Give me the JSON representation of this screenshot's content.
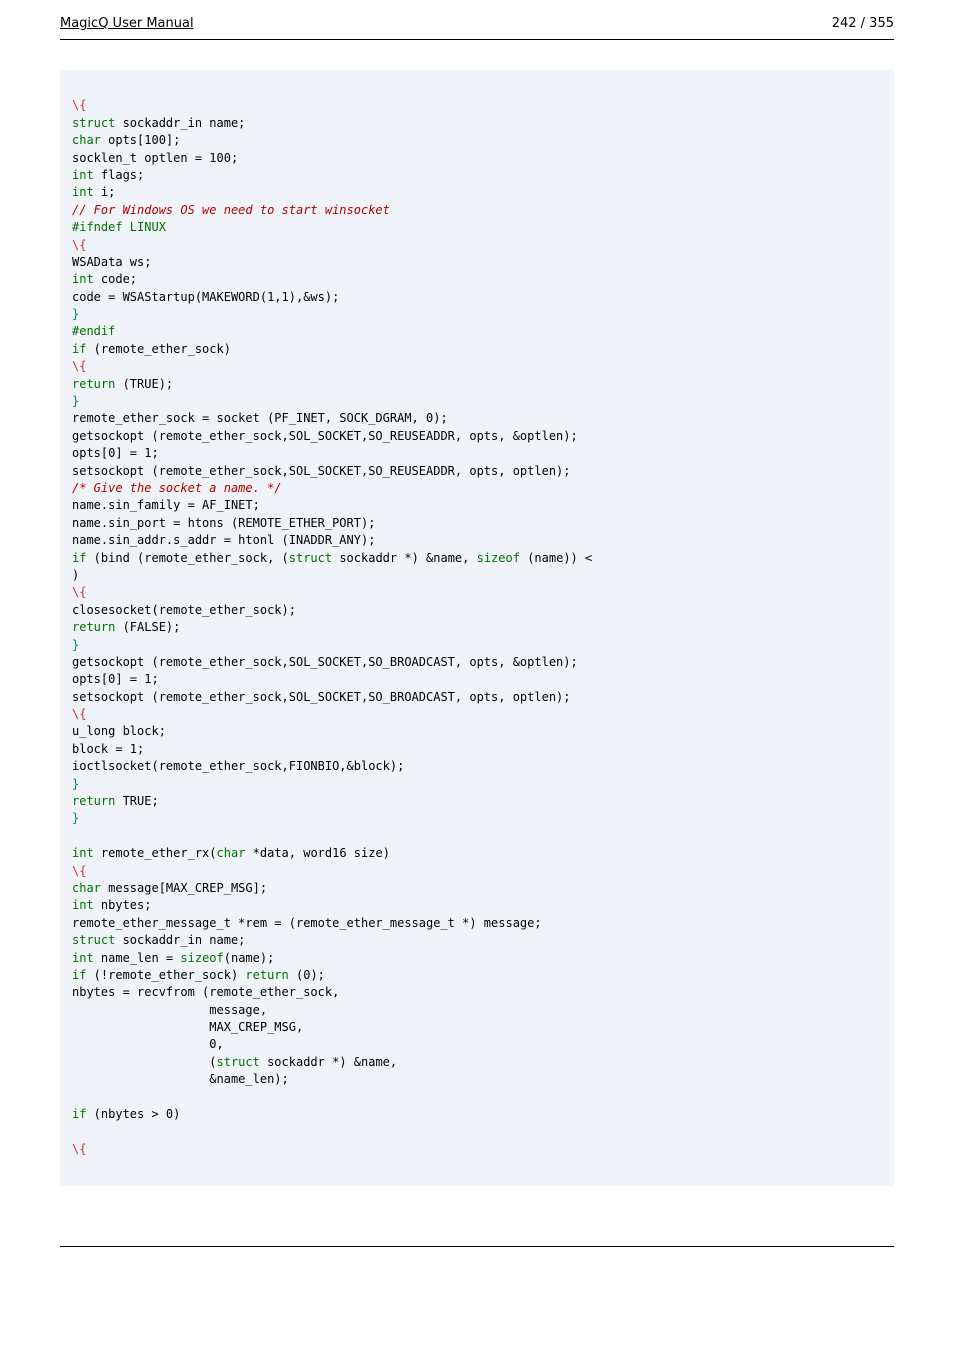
{
  "header": {
    "title_left": "MagicQ User Manual",
    "page_info": "242 / 355"
  },
  "code": {
    "lines": [
      [],
      [
        {
          "cls": "tok-bs",
          "t": "\\{"
        }
      ],
      [
        {
          "cls": "tok-kw",
          "t": "struct"
        },
        {
          "cls": "",
          "t": " sockaddr_in name;"
        }
      ],
      [
        {
          "cls": "tok-kw",
          "t": "char"
        },
        {
          "cls": "",
          "t": " opts[100];"
        }
      ],
      [
        {
          "cls": "",
          "t": "socklen_t optlen = 100;"
        }
      ],
      [
        {
          "cls": "tok-kw",
          "t": "int"
        },
        {
          "cls": "",
          "t": " flags;"
        }
      ],
      [
        {
          "cls": "tok-kw",
          "t": "int"
        },
        {
          "cls": "",
          "t": " i;"
        }
      ],
      [
        {
          "cls": "tok-comm",
          "t": "// For Windows OS we need to start winsocket"
        }
      ],
      [
        {
          "cls": "tok-pp",
          "t": "#ifndef LINUX"
        }
      ],
      [
        {
          "cls": "tok-bs",
          "t": "\\{"
        }
      ],
      [
        {
          "cls": "",
          "t": "WSAData ws;"
        }
      ],
      [
        {
          "cls": "tok-kw",
          "t": "int"
        },
        {
          "cls": "",
          "t": " code;"
        }
      ],
      [
        {
          "cls": "",
          "t": "code = WSAStartup(MAKEWORD(1,1),&ws);"
        }
      ],
      [
        {
          "cls": "tok-struct",
          "t": "}"
        }
      ],
      [
        {
          "cls": "tok-pp",
          "t": "#endif"
        }
      ],
      [
        {
          "cls": "tok-kw",
          "t": "if"
        },
        {
          "cls": "",
          "t": " (remote_ether_sock)"
        }
      ],
      [
        {
          "cls": "tok-bs",
          "t": "\\{"
        }
      ],
      [
        {
          "cls": "tok-kw",
          "t": "return"
        },
        {
          "cls": "",
          "t": " (TRUE);"
        }
      ],
      [
        {
          "cls": "tok-struct",
          "t": "}"
        }
      ],
      [
        {
          "cls": "",
          "t": "remote_ether_sock = socket (PF_INET, SOCK_DGRAM, 0);"
        }
      ],
      [
        {
          "cls": "",
          "t": "getsockopt (remote_ether_sock,SOL_SOCKET,SO_REUSEADDR, opts, &optlen);"
        }
      ],
      [
        {
          "cls": "",
          "t": "opts[0] = 1;"
        }
      ],
      [
        {
          "cls": "",
          "t": "setsockopt (remote_ether_sock,SOL_SOCKET,SO_REUSEADDR, opts, optlen);"
        }
      ],
      [
        {
          "cls": "tok-comm",
          "t": "/* Give the socket a name. */"
        }
      ],
      [
        {
          "cls": "",
          "t": "name.sin_family = AF_INET;"
        }
      ],
      [
        {
          "cls": "",
          "t": "name.sin_port = htons (REMOTE_ETHER_PORT);"
        }
      ],
      [
        {
          "cls": "",
          "t": "name.sin_addr.s_addr = htonl (INADDR_ANY);"
        }
      ],
      [
        {
          "cls": "tok-kw",
          "t": "if"
        },
        {
          "cls": "",
          "t": " (bind (remote_ether_sock, ("
        },
        {
          "cls": "tok-kw",
          "t": "struct"
        },
        {
          "cls": "",
          "t": " sockaddr *) &name, "
        },
        {
          "cls": "tok-kw",
          "t": "sizeof"
        },
        {
          "cls": "",
          "t": " (name)) <"
        }
      ],
      [
        {
          "cls": "",
          "t": ")"
        }
      ],
      [
        {
          "cls": "tok-bs",
          "t": "\\{"
        }
      ],
      [
        {
          "cls": "",
          "t": "closesocket(remote_ether_sock);"
        }
      ],
      [
        {
          "cls": "tok-kw",
          "t": "return"
        },
        {
          "cls": "",
          "t": " (FALSE);"
        }
      ],
      [
        {
          "cls": "tok-struct",
          "t": "}"
        }
      ],
      [
        {
          "cls": "",
          "t": "getsockopt (remote_ether_sock,SOL_SOCKET,SO_BROADCAST, opts, &optlen);"
        }
      ],
      [
        {
          "cls": "",
          "t": "opts[0] = 1;"
        }
      ],
      [
        {
          "cls": "",
          "t": "setsockopt (remote_ether_sock,SOL_SOCKET,SO_BROADCAST, opts, optlen);"
        }
      ],
      [
        {
          "cls": "tok-bs",
          "t": "\\{"
        }
      ],
      [
        {
          "cls": "",
          "t": "u_long block;"
        }
      ],
      [
        {
          "cls": "",
          "t": "block = 1;"
        }
      ],
      [
        {
          "cls": "",
          "t": "ioctlsocket(remote_ether_sock,FIONBIO,&block);"
        }
      ],
      [
        {
          "cls": "tok-struct",
          "t": "}"
        }
      ],
      [
        {
          "cls": "tok-kw",
          "t": "return"
        },
        {
          "cls": "",
          "t": " TRUE;"
        }
      ],
      [
        {
          "cls": "tok-struct",
          "t": "}"
        }
      ],
      [],
      [
        {
          "cls": "tok-kw",
          "t": "int"
        },
        {
          "cls": "",
          "t": " remote_ether_rx("
        },
        {
          "cls": "tok-kw",
          "t": "char"
        },
        {
          "cls": "",
          "t": " *data, word16 size)"
        }
      ],
      [
        {
          "cls": "tok-bs",
          "t": "\\{"
        }
      ],
      [
        {
          "cls": "tok-kw",
          "t": "char"
        },
        {
          "cls": "",
          "t": " message[MAX_CREP_MSG];"
        }
      ],
      [
        {
          "cls": "tok-kw",
          "t": "int"
        },
        {
          "cls": "",
          "t": " nbytes;"
        }
      ],
      [
        {
          "cls": "",
          "t": "remote_ether_message_t *rem = (remote_ether_message_t *) message;"
        }
      ],
      [
        {
          "cls": "tok-kw",
          "t": "struct"
        },
        {
          "cls": "",
          "t": " sockaddr_in name;"
        }
      ],
      [
        {
          "cls": "tok-kw",
          "t": "int"
        },
        {
          "cls": "",
          "t": " name_len = "
        },
        {
          "cls": "tok-kw",
          "t": "sizeof"
        },
        {
          "cls": "",
          "t": "(name);"
        }
      ],
      [
        {
          "cls": "tok-kw",
          "t": "if"
        },
        {
          "cls": "",
          "t": " (!remote_ether_sock) "
        },
        {
          "cls": "tok-kw",
          "t": "return"
        },
        {
          "cls": "",
          "t": " (0);"
        }
      ],
      [
        {
          "cls": "",
          "t": "nbytes = recvfrom (remote_ether_sock,"
        }
      ],
      [
        {
          "cls": "",
          "t": "                   message,"
        }
      ],
      [
        {
          "cls": "",
          "t": "                   MAX_CREP_MSG,"
        }
      ],
      [
        {
          "cls": "",
          "t": "                   0,"
        }
      ],
      [
        {
          "cls": "",
          "t": "                   ("
        },
        {
          "cls": "tok-kw",
          "t": "struct"
        },
        {
          "cls": "",
          "t": " sockaddr *) &name,"
        }
      ],
      [
        {
          "cls": "",
          "t": "                   &name_len);"
        }
      ],
      [],
      [
        {
          "cls": "tok-kw",
          "t": "if"
        },
        {
          "cls": "",
          "t": " (nbytes > 0)"
        }
      ],
      [],
      [
        {
          "cls": "tok-bs",
          "t": "\\{"
        }
      ],
      []
    ]
  }
}
